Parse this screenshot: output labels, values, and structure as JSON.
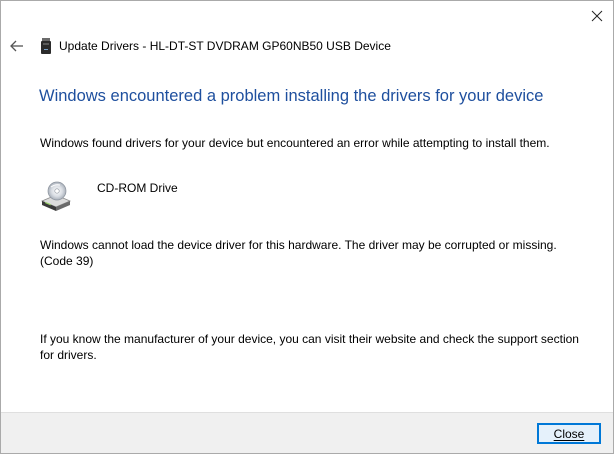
{
  "window": {
    "title": "Update Drivers - HL-DT-ST DVDRAM GP60NB50 USB Device",
    "close_glyph": "✕"
  },
  "icons": {
    "back": "back-arrow-icon",
    "device": "usb-device-icon",
    "drive": "cd-rom-drive-icon",
    "close": "close-icon"
  },
  "main": {
    "heading": "Windows encountered a problem installing the drivers for your device",
    "intro": "Windows found drivers for your device but encountered an error while attempting to install them.",
    "device_name": "CD-ROM Drive",
    "error_message": "Windows cannot load the device driver for this hardware. The driver may be corrupted or missing. (Code 39)",
    "support_hint": "If you know the manufacturer of your device, you can visit their website and check the support section for drivers."
  },
  "footer": {
    "close_label": "Close"
  },
  "colors": {
    "heading": "#1e4f9e",
    "button_border": "#0078d7",
    "button_fill": "#e5f1fb",
    "footer_bg": "#f0f0f0"
  }
}
